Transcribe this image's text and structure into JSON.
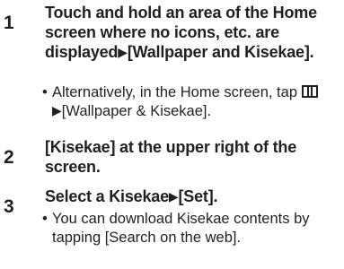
{
  "steps": [
    {
      "number": "1",
      "title_a": "Touch and hold an area of the Home screen where no icons, etc. are displayed",
      "title_b": "[Wallpaper and Kisekae].",
      "note_a": "Alternatively, in the Home screen, tap",
      "note_b": "[Wallpaper & Kisekae].",
      "note_icon": "apps-grid-icon"
    },
    {
      "number": "2",
      "title_a": "[Kisekae] at the upper right of the screen."
    },
    {
      "number": "3",
      "title_a": "Select a Kisekae",
      "title_b": "[Set].",
      "note_a": "You can download Kisekae contents by tapping [Search on the web]."
    }
  ],
  "glyphs": {
    "arrow": "▶",
    "bullet": "•"
  }
}
